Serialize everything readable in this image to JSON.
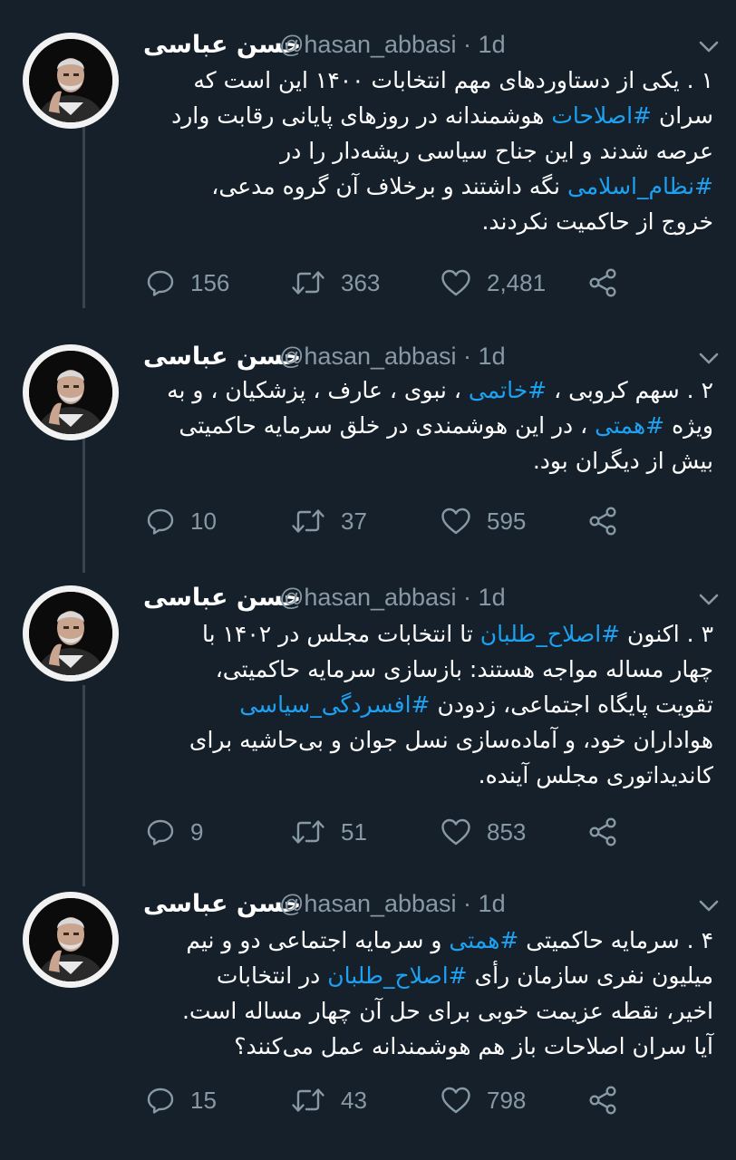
{
  "tweets": [
    {
      "name": "حسن عباسی",
      "handle": "@hasan_abbasi · 1d",
      "lines": [
        [
          {
            "t": "۱ . یکی از دستاوردهای مهم انتخابات ۱۴۰۰ این است که"
          }
        ],
        [
          {
            "t": "سران "
          },
          {
            "t": "#اصلاحات",
            "h": true
          },
          {
            "t": " هوشمندانه در روزهای پایانی رقابت وارد"
          }
        ],
        [
          {
            "t": "عرصه شدند و این جناح سیاسی ریشه‌دار را در"
          }
        ],
        [
          {
            "t": "#نظام_اسلامی",
            "h": true
          },
          {
            "t": " نگه داشتند و برخلاف آن گروه مدعی،"
          }
        ],
        [
          {
            "t": "خروج از حاکمیت نکردند."
          }
        ]
      ],
      "replies": "156",
      "retweets": "363",
      "likes": "2,481"
    },
    {
      "name": "حسن عباسی",
      "handle": "@hasan_abbasi · 1d",
      "lines": [
        [
          {
            "t": "۲ . سهم کروبی ، "
          },
          {
            "t": "#خاتمی",
            "h": true
          },
          {
            "t": " ، نبوی ، عارف ، پزشکیان ، و به"
          }
        ],
        [
          {
            "t": "ویژه "
          },
          {
            "t": "#همتی",
            "h": true
          },
          {
            "t": " ، در این هوشمندی در خلق سرمایه حاکمیتی"
          }
        ],
        [
          {
            "t": "بیش از دیگران بود."
          }
        ]
      ],
      "replies": "10",
      "retweets": "37",
      "likes": "595"
    },
    {
      "name": "حسن عباسی",
      "handle": "@hasan_abbasi · 1d",
      "lines": [
        [
          {
            "t": "۳ . اکنون "
          },
          {
            "t": "#اصلاح_طلبان",
            "h": true
          },
          {
            "t": " تا انتخابات مجلس در ۱۴۰۲ با"
          }
        ],
        [
          {
            "t": "چهار مساله مواجه هستند: بازسازی سرمایه حاکمیتی،"
          }
        ],
        [
          {
            "t": "تقویت پایگاه اجتماعی، زدودن "
          },
          {
            "t": "#افسردگی_سیاسی",
            "h": true
          }
        ],
        [
          {
            "t": "هواداران خود، و آماده‌سازی نسل جوان و بی‌حاشیه برای"
          }
        ],
        [
          {
            "t": "کاندیداتوری مجلس آینده."
          }
        ]
      ],
      "replies": "9",
      "retweets": "51",
      "likes": "853"
    },
    {
      "name": "حسن عباسی",
      "handle": "@hasan_abbasi · 1d",
      "lines": [
        [
          {
            "t": "۴ . سرمایه حاکمیتی "
          },
          {
            "t": "#همتی",
            "h": true
          },
          {
            "t": " و سرمایه اجتماعی دو و نیم"
          }
        ],
        [
          {
            "t": "میلیون نفری سازمان رأی "
          },
          {
            "t": "#اصلاح_طلبان",
            "h": true
          },
          {
            "t": " در انتخابات"
          }
        ],
        [
          {
            "t": "اخیر، نقطه عزیمت خوبی برای حل آن چهار مساله است."
          }
        ],
        [
          {
            "t": "آیا سران اصلاحات باز هم هوشمندانه عمل می‌کنند؟"
          }
        ]
      ],
      "replies": "15",
      "retweets": "43",
      "likes": "798"
    }
  ],
  "colors": {
    "background": "#15202b",
    "text": "#ffffff",
    "secondary": "#8899a6",
    "hashtag": "#1da1f2",
    "thread_line": "#38444d"
  },
  "icons": {
    "reply": "reply-bubble-icon",
    "retweet": "retweet-icon",
    "like": "heart-icon",
    "share": "share-icon",
    "menu": "chevron-down-icon"
  }
}
